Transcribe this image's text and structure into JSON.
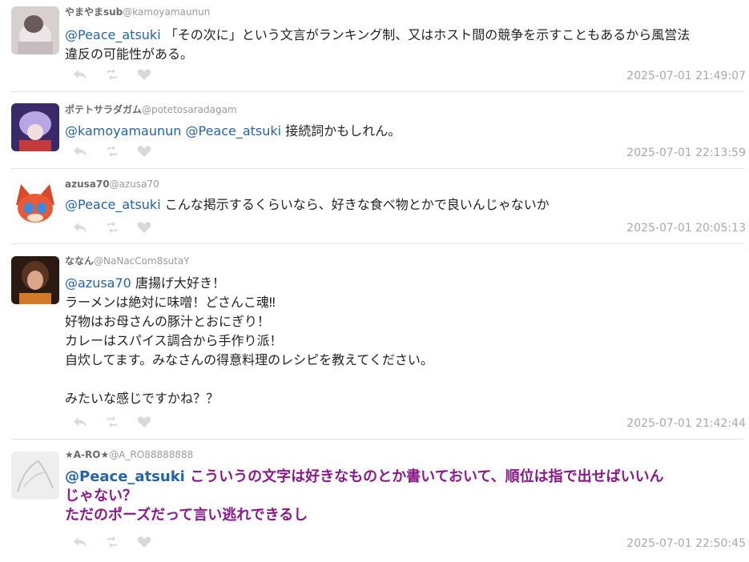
{
  "posts": [
    {
      "user": "やまやまsub",
      "handle": "@kamoyamaunun",
      "mentions": [
        "@Peace_atsuki"
      ],
      "lines": [
        "「その次に」という文言がランキング制、又はホスト間の競争を示すこともあるから風営法",
        "違反の可能性がある。"
      ],
      "time": "2025-07-01 21:49:07"
    },
    {
      "user": "ポテトサラダガム",
      "handle": "@potetosaradagam",
      "mentions": [
        "@kamoyamaunun",
        "@Peace_atsuki"
      ],
      "lines": [
        "接続詞かもしれん。"
      ],
      "time": "2025-07-01 22:13:59"
    },
    {
      "user": "azusa70",
      "handle": "@azusa70",
      "mentions": [
        "@Peace_atsuki"
      ],
      "lines": [
        "こんな掲示するくらいなら、好きな食べ物とかで良いんじゃないか"
      ],
      "time": "2025-07-01 20:05:13"
    },
    {
      "user": "ななん",
      "handle": "@NaNacCom8sutaY",
      "mentions": [
        "@azusa70"
      ],
      "lines": [
        "唐揚げ大好き！",
        "ラーメンは絶対に味噌！どさんこ魂‼",
        "好物はお母さんの豚汁とおにぎり！",
        "カレーはスパイス調合から手作り派！",
        "自炊してます。みなさんの得意料理のレシピを教えてください。",
        "",
        "みたいな感じですかね？？"
      ],
      "time": "2025-07-01 21:42:44"
    },
    {
      "user": "★A-RO★",
      "handle": "@A_RO88888888",
      "mentions": [
        "@Peace_atsuki"
      ],
      "lines": [
        "こういうの文字は好きなものとか書いておいて、順位は指で出せばいいん",
        "じゃない？",
        "ただのポーズだって言い逃れできるし"
      ],
      "time": "2025-07-01 22:50:45"
    }
  ],
  "icons": {
    "reply": "reply-icon",
    "retweet": "retweet-icon",
    "like": "heart-icon"
  },
  "colors": {
    "mention": "#2563a8",
    "highlight_text": "#8a1a8a",
    "timestamp": "#a8a8a8",
    "action_icon": "#d9d9d9"
  }
}
